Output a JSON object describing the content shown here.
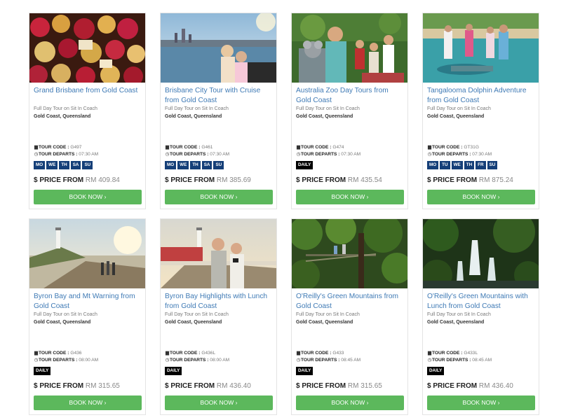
{
  "book_label": "BOOK NOW",
  "book_arrow": "›",
  "tour_code_label": "TOUR CODE :",
  "tour_departs_label": "TOUR DEPARTS :",
  "price_label": "$ PRICE FROM",
  "tours": [
    {
      "title": "Grand Brisbane from Gold Coast",
      "subtitle": "Full Day Tour on Sit In Coach",
      "location": "Gold Coast, Queensland",
      "code": "G497",
      "departs": "07:30 AM",
      "days": [
        "MO",
        "WE",
        "TH",
        "SA",
        "SU"
      ],
      "price": "RM 409.84"
    },
    {
      "title": "Brisbane City Tour with Cruise from Gold Coast",
      "subtitle": "Full Day Tour on Sit In Coach",
      "location": "Gold Coast, Queensland",
      "code": "G461",
      "departs": "07:30 AM",
      "days": [
        "MO",
        "WE",
        "TH",
        "SA",
        "SU"
      ],
      "price": "RM 385.69"
    },
    {
      "title": "Australia Zoo Day Tours from Gold Coast",
      "subtitle": "Full Day Tour on Sit In Coach",
      "location": "Gold Coast, Queensland",
      "code": "G474",
      "departs": "07:30 AM",
      "days": [
        "DAILY"
      ],
      "price": "RM 435.54"
    },
    {
      "title": "Tangalooma Dolphin Adventure from Gold Coast",
      "subtitle": "Full Day Tour on Sit In Coach",
      "location": "Gold Coast, Queensland",
      "code": "GT31G",
      "departs": "07:30 AM",
      "days": [
        "MO",
        "TU",
        "WE",
        "TH",
        "FR",
        "SU"
      ],
      "price": "RM 875.24"
    },
    {
      "title": "Byron Bay and Mt Warning from Gold Coast",
      "subtitle": "Full Day Tour on Sit In Coach",
      "location": "Gold Coast, Queensland",
      "code": "G436",
      "departs": "08:00 AM",
      "days": [
        "DAILY"
      ],
      "price": "RM 315.65"
    },
    {
      "title": "Byron Bay Highlights with Lunch from Gold Coast",
      "subtitle": "Full Day Tour on Sit In Coach",
      "location": "Gold Coast, Queensland",
      "code": "G436L",
      "departs": "08:00 AM",
      "days": [
        "DAILY"
      ],
      "price": "RM 436.40"
    },
    {
      "title": "O'Reilly's Green Mountains from Gold Coast",
      "subtitle": "Full Day Tour on Sit In Coach",
      "location": "Gold Coast, Queensland",
      "code": "G433",
      "departs": "08:45 AM",
      "days": [
        "DAILY"
      ],
      "price": "RM 315.65"
    },
    {
      "title": "O'Reilly's Green Mountains with Lunch from Gold Coast",
      "subtitle": "Full Day Tour on Sit In Coach",
      "location": "Gold Coast, Queensland",
      "code": "G433L",
      "departs": "08:45 AM",
      "days": [
        "DAILY"
      ],
      "price": "RM 436.40"
    }
  ]
}
